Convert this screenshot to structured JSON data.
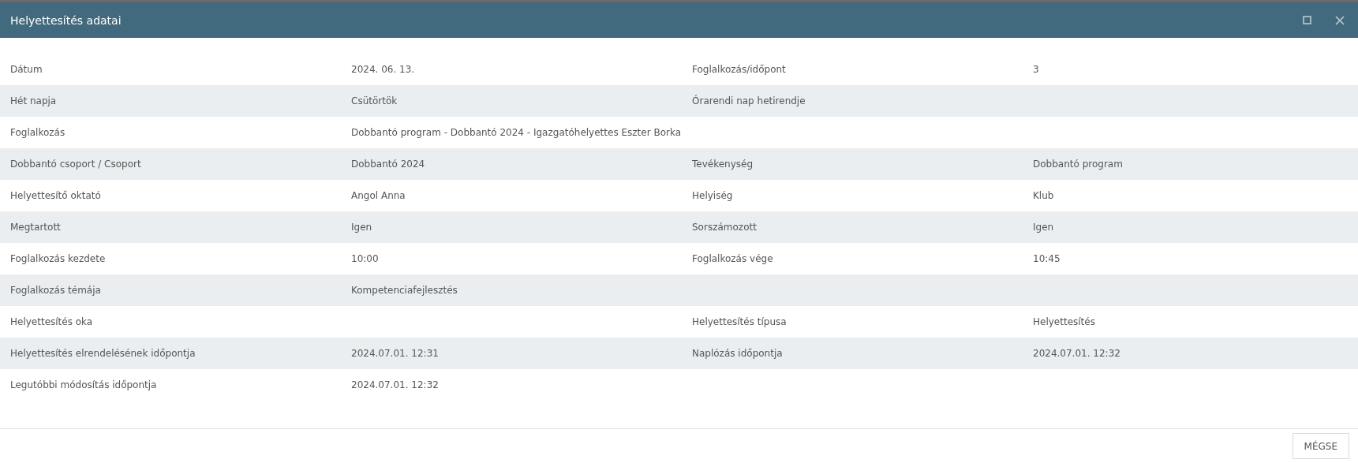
{
  "window": {
    "title": "Helyettesítés adatai"
  },
  "rows": [
    {
      "pairs": [
        {
          "label": "Dátum",
          "value": "2024. 06. 13."
        },
        {
          "label": "Foglalkozás/időpont",
          "value": "3"
        }
      ]
    },
    {
      "pairs": [
        {
          "label": "Hét napja",
          "value": "Csütörtök"
        },
        {
          "label": "Órarendi nap hetirendje"
        }
      ]
    },
    {
      "pairs": [
        {
          "label": "Foglalkozás",
          "value": "Dobbantó program - Dobbantó 2024 - Igazgatóhelyettes Eszter Borka"
        }
      ]
    },
    {
      "pairs": [
        {
          "label": "Dobbantó csoport / Csoport",
          "value": "Dobbantó 2024"
        },
        {
          "label": "Tevékenység",
          "value": "Dobbantó program"
        }
      ]
    },
    {
      "pairs": [
        {
          "label": "Helyettesítő oktató",
          "value": "Angol Anna"
        },
        {
          "label": "Helyiség",
          "value": "Klub"
        }
      ]
    },
    {
      "pairs": [
        {
          "label": "Megtartott",
          "value": "Igen"
        },
        {
          "label": "Sorszámozott",
          "value": "Igen"
        }
      ]
    },
    {
      "pairs": [
        {
          "label": "Foglalkozás kezdete",
          "value": "10:00"
        },
        {
          "label": "Foglalkozás vége",
          "value": "10:45"
        }
      ]
    },
    {
      "pairs": [
        {
          "label": "Foglalkozás témája",
          "value": "Kompetenciafejlesztés"
        }
      ]
    },
    {
      "pairs": [
        {
          "label": "Helyettesítés oka"
        },
        {
          "label": "Helyettesítés típusa",
          "value": "Helyettesítés"
        }
      ]
    },
    {
      "pairs": [
        {
          "label": "Helyettesítés elrendelésének időpontja",
          "value": "2024.07.01. 12:31"
        },
        {
          "label": "Naplózás időpontja",
          "value": "2024.07.01. 12:32"
        }
      ]
    },
    {
      "pairs": [
        {
          "label": "Legutóbbi módosítás időpontja",
          "value": "2024.07.01. 12:32"
        }
      ]
    }
  ],
  "buttons": [
    "MÉGSE"
  ]
}
